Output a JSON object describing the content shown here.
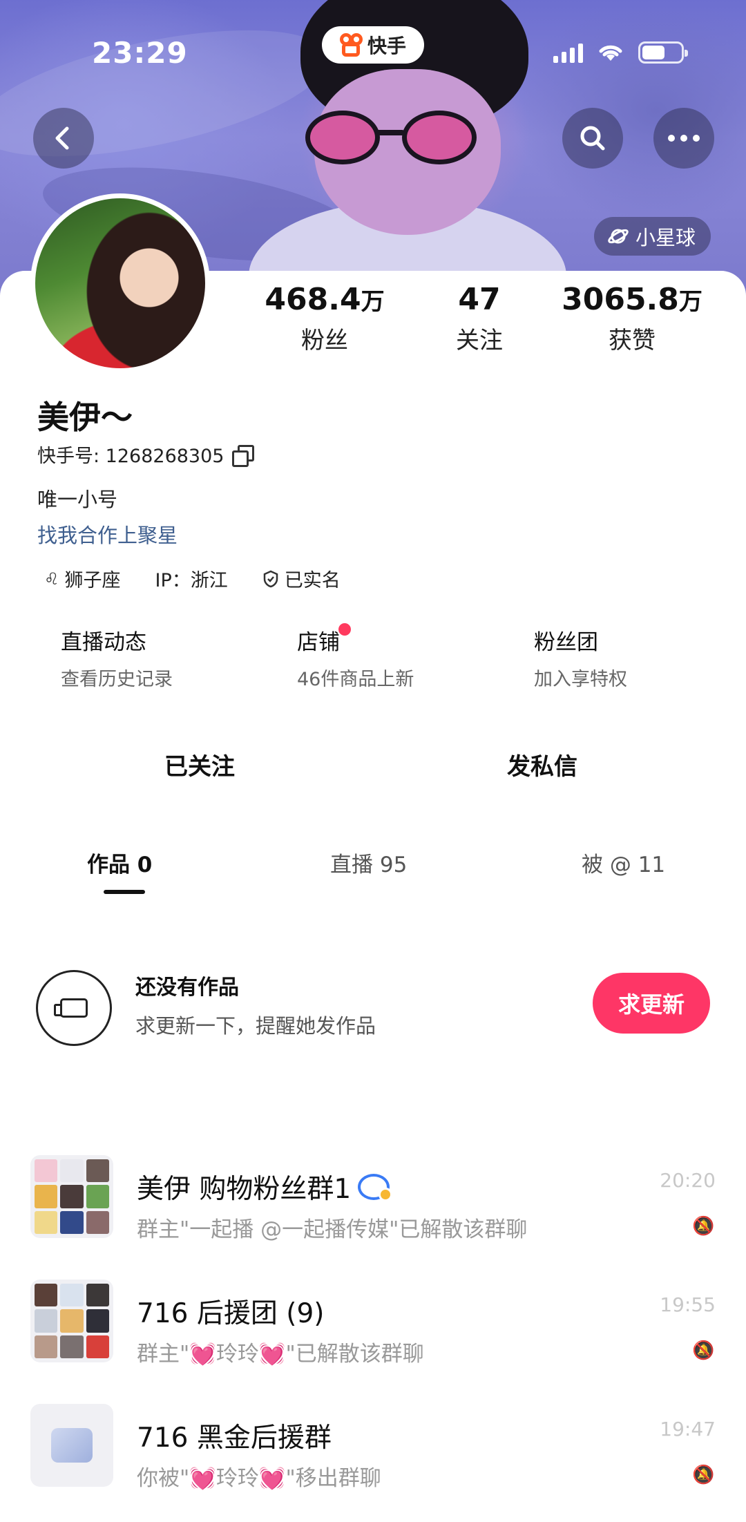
{
  "status_bar": {
    "time": "23:29",
    "app_name": "快手"
  },
  "header": {
    "planet_label": "小星球"
  },
  "profile": {
    "stats": [
      {
        "number": "468.4",
        "unit": "万",
        "label": "粉丝"
      },
      {
        "number": "47",
        "unit": "",
        "label": "关注"
      },
      {
        "number": "3065.8",
        "unit": "万",
        "label": "获赞"
      }
    ],
    "nickname": "美伊～",
    "kuaishou_id": "快手号: 1268268305",
    "bio_line1": "唯一小号",
    "bio_line2": "找我合作上聚星",
    "tags": [
      "狮子座",
      "IP：浙江",
      "已实名"
    ]
  },
  "features": [
    {
      "title": "直播动态",
      "subtitle": "查看历史记录"
    },
    {
      "title": "店铺",
      "subtitle": "46件商品上新"
    },
    {
      "title": "粉丝团",
      "subtitle": "加入享特权"
    }
  ],
  "actions": {
    "followed": "已关注",
    "message": "发私信"
  },
  "tabs": [
    "作品 0",
    "直播 95",
    "被 @ 11"
  ],
  "empty_state": {
    "title": "还没有作品",
    "subtitle": "求更新一下，提醒她发作品",
    "button": "求更新"
  },
  "chats": [
    {
      "name": "美伊 购物粉丝群1",
      "preview_a": "群主\"一起播 @一起播传媒\"已解散该群聊",
      "preview_b": "",
      "preview_c": "",
      "time": "20:20"
    },
    {
      "name": "716 后援团 (9)",
      "preview_a": "群主\"",
      "preview_b": "玲玲",
      "preview_c": "\"已解散该群聊",
      "time": "19:55"
    },
    {
      "name": "716 黑金后援群",
      "preview_a": "你被\"",
      "preview_b": "玲玲",
      "preview_c": "\"移出群聊",
      "time": "19:47"
    }
  ],
  "colors": {
    "accent": "#fe3666",
    "link": "#3f5f8f",
    "heart": "#f0528a"
  }
}
